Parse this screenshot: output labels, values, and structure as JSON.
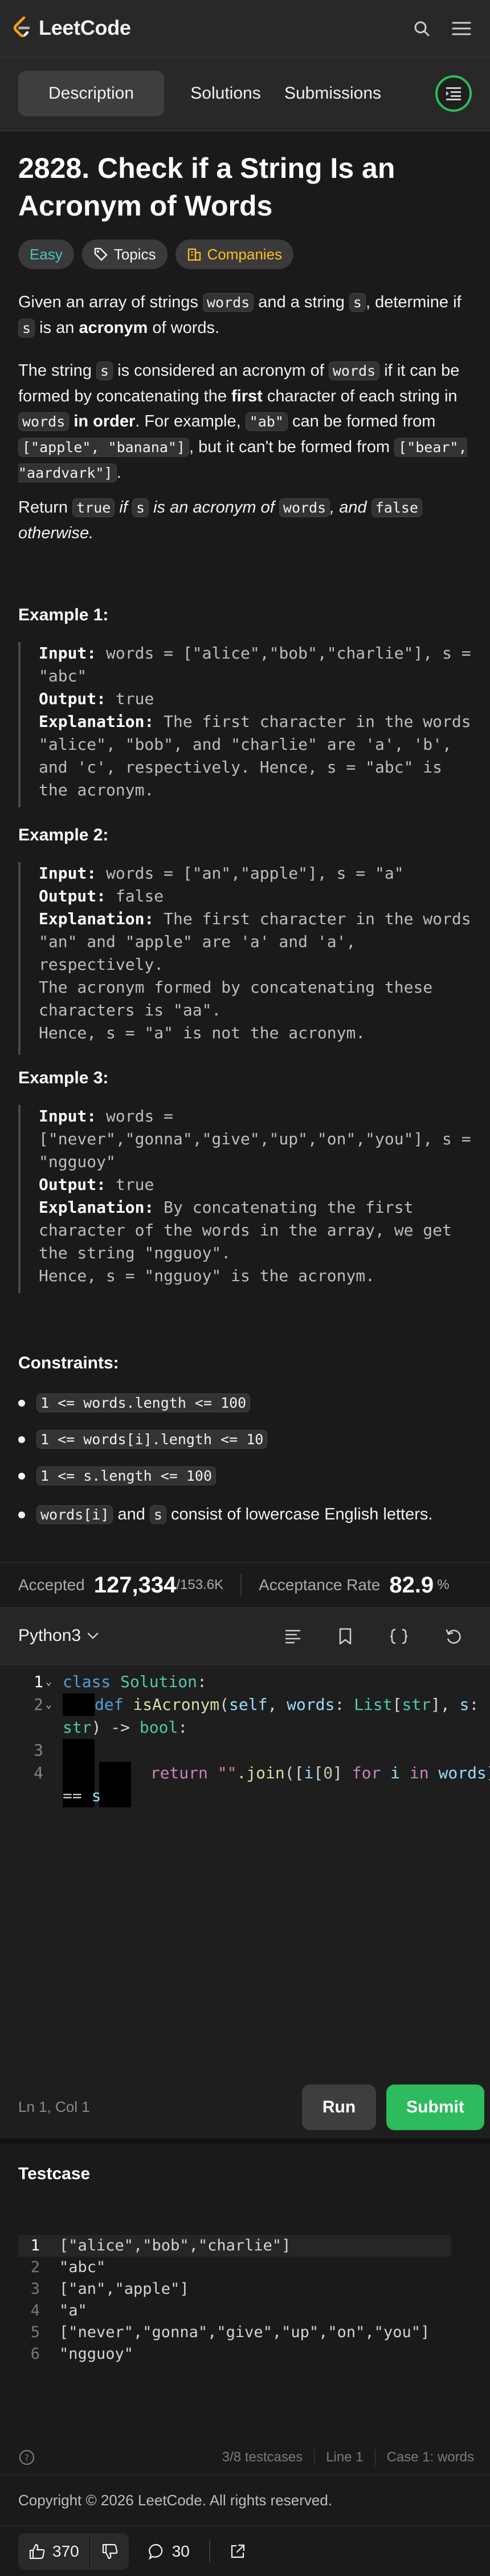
{
  "app": {
    "logo_text": "LeetCode"
  },
  "tabs": {
    "description": "Description",
    "solutions": "Solutions",
    "submissions": "Submissions"
  },
  "problem": {
    "title": "2828. Check if a String Is an Acronym of Words",
    "tags": {
      "difficulty": "Easy",
      "topics": "Topics",
      "companies": "Companies"
    },
    "p1_a": "Given an array of strings ",
    "p1_b": "words",
    "p1_c": " and a string ",
    "p1_d": "s",
    "p1_e": ", determine if ",
    "p1_f": "s",
    "p1_g": " is an ",
    "p1_h": "acronym",
    "p1_i": " of words.",
    "p2_a": "The string ",
    "p2_b": "s",
    "p2_c": " is considered an acronym of ",
    "p2_d": "words",
    "p2_e": " if it can be formed by concatenating the ",
    "p2_f": "first",
    "p2_g": " character of each string in ",
    "p2_h": "words",
    "p2_i": " in order",
    "p2_j": ". For example, ",
    "p2_k": "\"ab\"",
    "p2_l": " can be formed from ",
    "p2_m": "[\"apple\", \"banana\"]",
    "p2_n": ", but it can't be formed from ",
    "p2_o": "[\"bear\", \"aardvark\"]",
    "p2_p": ".",
    "p3_a": "Return ",
    "p3_b": "true",
    "p3_c": " if ",
    "p3_d": "s",
    "p3_e": " is an acronym of ",
    "p3_f": "words",
    "p3_g": ", and ",
    "p3_h": "false",
    "p3_i": " otherwise."
  },
  "examples": [
    {
      "heading": "Example 1:",
      "input_label": "Input:",
      "input": " words = [\"alice\",\"bob\",\"charlie\"], s = \"abc\"",
      "output_label": "Output:",
      "output": " true",
      "explanation_label": "Explanation:",
      "explanation": " The first character in the words \"alice\", \"bob\", and \"charlie\" are 'a', 'b', and 'c', respectively. Hence, s = \"abc\" is the acronym."
    },
    {
      "heading": "Example 2:",
      "input_label": "Input:",
      "input": " words = [\"an\",\"apple\"], s = \"a\"",
      "output_label": "Output:",
      "output": " false",
      "explanation_label": "Explanation:",
      "explanation": " The first character in the words \"an\" and \"apple\" are 'a' and 'a', respectively.\nThe acronym formed by concatenating these characters is \"aa\".\nHence, s = \"a\" is not the acronym."
    },
    {
      "heading": "Example 3:",
      "input_label": "Input:",
      "input": " words = [\"never\",\"gonna\",\"give\",\"up\",\"on\",\"you\"], s = \"ngguoy\"",
      "output_label": "Output:",
      "output": " true",
      "explanation_label": "Explanation:",
      "explanation": " By concatenating the first character of the words in the array, we get the string \"ngguoy\".\nHence, s = \"ngguoy\" is the acronym."
    }
  ],
  "constraints": {
    "heading": "Constraints:",
    "items": [
      "1 <= words.length <= 100",
      "1 <= words[i].length <= 10",
      "1 <= s.length <= 100"
    ],
    "last_a": "words[i]",
    "last_b": " and ",
    "last_c": "s",
    "last_d": " consist of lowercase English letters."
  },
  "stats": {
    "accepted_label": "Accepted",
    "accepted_value": "127,334",
    "accepted_total": "/153.6K",
    "rate_label": "Acceptance Rate",
    "rate_value": "82.9",
    "rate_unit": "%"
  },
  "editor": {
    "language": "Python3",
    "line_numbers": [
      "1",
      "2",
      "",
      "3",
      "4",
      ""
    ],
    "cursor": "Ln 1, Col 1",
    "run_label": "Run",
    "submit_label": "Submit"
  },
  "testcase": {
    "title": "Testcase",
    "line_numbers": [
      "1",
      "2",
      "3",
      "4",
      "5",
      "6"
    ],
    "lines": [
      "[\"alice\",\"bob\",\"charlie\"]",
      "\"abc\"",
      "[\"an\",\"apple\"]",
      "\"a\"",
      "[\"never\",\"gonna\",\"give\",\"up\",\"on\",\"you\"]",
      "\"ngguoy\""
    ],
    "count": "3/8 testcases",
    "line": "Line 1",
    "case": "Case 1: words"
  },
  "footer": {
    "copyright": "Copyright © 2026 LeetCode. All rights reserved."
  },
  "bottom": {
    "likes": "370",
    "comments": "30"
  },
  "colors": {
    "accent": "#ffa116",
    "green": "#2cbb5d",
    "easy": "#46c6c2",
    "companies": "#ffc01e"
  }
}
